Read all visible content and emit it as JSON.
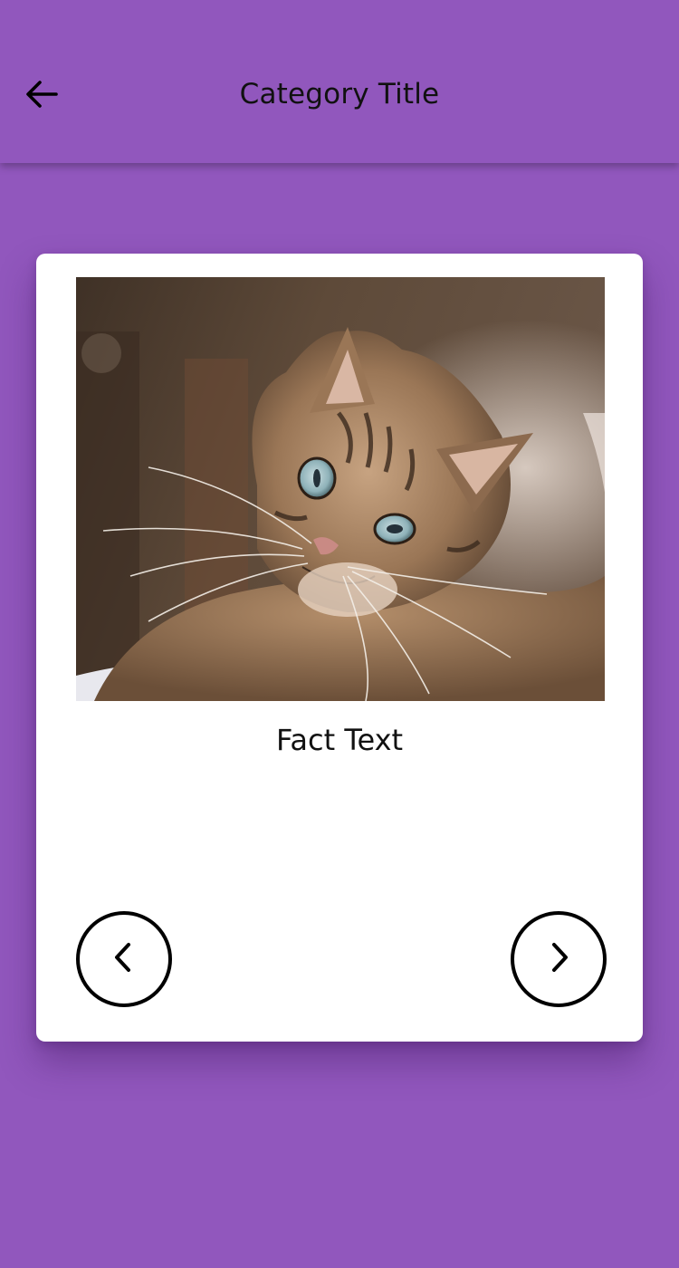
{
  "app_bar": {
    "title": "Category Title",
    "back_icon": "arrow-left-icon",
    "background_color": "#9157bd"
  },
  "card": {
    "image_subject": "tabby cat",
    "fact_text": "Fact Text",
    "prev_icon": "chevron-left-icon",
    "next_icon": "chevron-right-icon"
  },
  "colors": {
    "background": "#9157bd",
    "card": "#ffffff",
    "text": "#111111"
  }
}
